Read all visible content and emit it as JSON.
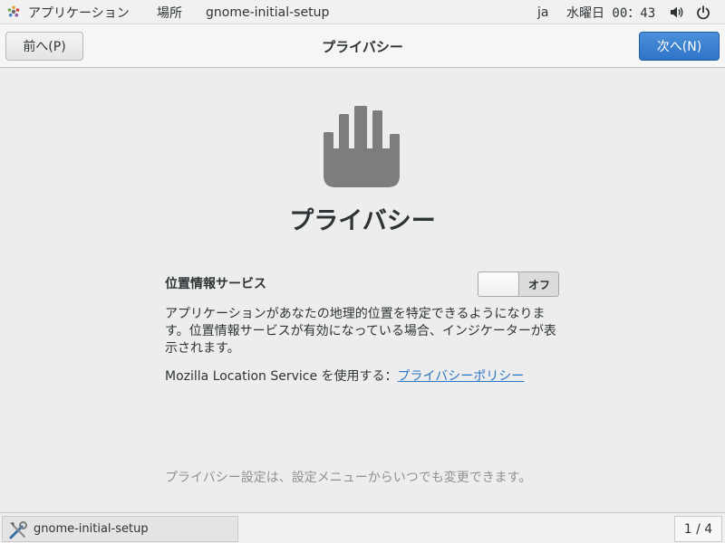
{
  "topbar": {
    "apps_label": "アプリケーション",
    "places_label": "場所",
    "app_name": "gnome-initial-setup",
    "language": "ja",
    "clock": "水曜日 00：43",
    "icons": [
      "gnome-logo-icon",
      "volume-icon",
      "power-icon"
    ]
  },
  "header": {
    "prev_label": "前へ(P)",
    "title": "プライバシー",
    "next_label": "次へ(N)"
  },
  "main": {
    "icon": "hand-icon",
    "heading": "プライバシー",
    "location_label": "位置情報サービス",
    "location_toggle": {
      "state_label": "オフ",
      "on": false
    },
    "description": "アプリケーションがあなたの地理的位置を特定できるようになります。位置情報サービスが有効になっている場合、インジケーターが表示されます。",
    "mls_text": "Mozilla Location Service を使用する：",
    "policy_link": "プライバシーポリシー",
    "footnote": "プライバシー設定は、設定メニューからいつでも変更できます。"
  },
  "taskbar": {
    "window_label": "gnome-initial-setup",
    "pager": "1 / 4"
  },
  "colors": {
    "accent": "#2f74c7",
    "link": "#2a76c6",
    "footnote": "#8f9190",
    "icon_gray": "#7d7d7d"
  }
}
